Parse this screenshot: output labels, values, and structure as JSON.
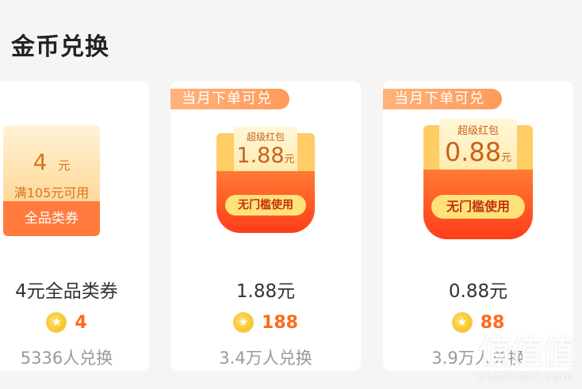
{
  "section": {
    "title": "金币兑换"
  },
  "cards": [
    {
      "coupon": {
        "value": "4",
        "unit": "元",
        "condition": "满105元可用",
        "type": "全品类券"
      },
      "name": "4元全品类券",
      "price": "4",
      "exchanged": "5336人兑换"
    },
    {
      "tag": "当月下单可兑",
      "envelope": {
        "label": "超级红包",
        "amount": "1.88",
        "unit": "元",
        "button": "无门槛使用"
      },
      "name": "1.88元",
      "price": "188",
      "exchanged": "3.4万人兑换"
    },
    {
      "tag": "当月下单可兑",
      "envelope": {
        "label": "超级红包",
        "amount": "0.88",
        "unit": "元",
        "button": "无门槛使用"
      },
      "name": "0.88元",
      "price": "88",
      "exchanged": "3.9万人兑换"
    }
  ],
  "coin_icon": "star-coin-icon",
  "watermark": {
    "logo": "值值值",
    "site": "zhizhizhi.com"
  },
  "colors": {
    "accent": "#ff6a1a",
    "tag": "#ff9a5a",
    "envelope": "#ff3d1a"
  }
}
